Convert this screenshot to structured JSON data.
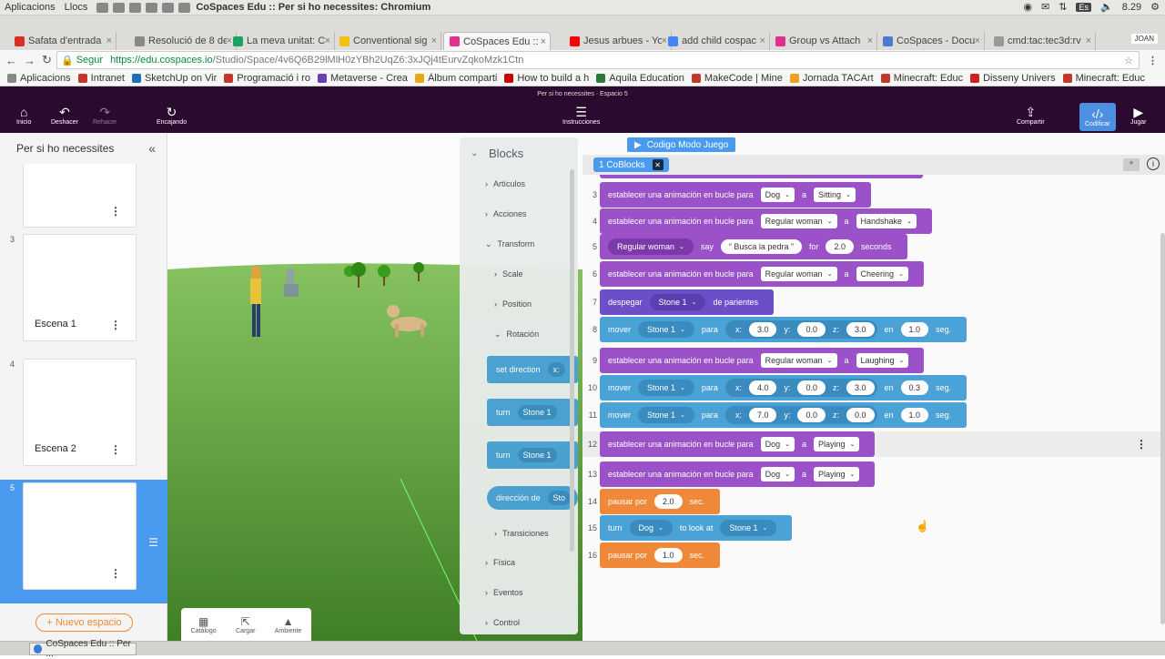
{
  "system": {
    "menus": [
      "Aplicacions",
      "Llocs"
    ],
    "window_title": "CoSpaces Edu :: Per si ho necessites: Chromium",
    "keyboard": "Es",
    "time": "8.29"
  },
  "browser": {
    "tabs": [
      {
        "label": "Safata d'entrada",
        "color": "#d93025"
      },
      {
        "label": "Resolució de 8 de",
        "color": "#888888"
      },
      {
        "label": "La meva unitat: C",
        "color": "#1aa260"
      },
      {
        "label": "Conventional sig",
        "color": "#f4c20d"
      },
      {
        "label": "CoSpaces Edu :: P",
        "color": "#e0318f",
        "active": true
      },
      {
        "label": "Jesus arbues - Yo",
        "color": "#ff0000"
      },
      {
        "label": "add child cospac",
        "color": "#4285f4"
      },
      {
        "label": "Group vs Attach",
        "color": "#e0318f"
      },
      {
        "label": "CoSpaces - Docu",
        "color": "#4a7bd0"
      },
      {
        "label": "cmd:tac:tec3d:rv",
        "color": "#999999"
      }
    ],
    "user": "JOAN",
    "secure_label": "Segur",
    "url_host": "https://edu.cospaces.io",
    "url_path": "/Studio/Space/4v6Q6B29lMlH0zYBh2UqZ6:3xJQj4tEurvZqkoMzk1Ctn",
    "bookmarks": [
      {
        "label": "Aplicacions",
        "color": "#888888"
      },
      {
        "label": "Intranet",
        "color": "#c0392b"
      },
      {
        "label": "SketchUp on Vir",
        "color": "#1e6fb8"
      },
      {
        "label": "Programació i ro",
        "color": "#c0392b"
      },
      {
        "label": "Metaverse - Crea",
        "color": "#6a3fb8"
      },
      {
        "label": "Àlbum comparti",
        "color": "#e6a817"
      },
      {
        "label": "How to build a h",
        "color": "#cc0000"
      },
      {
        "label": "Aquila Education",
        "color": "#2c7a3a"
      },
      {
        "label": "MakeCode | Mine",
        "color": "#c0392b"
      },
      {
        "label": "Jornada TACArt",
        "color": "#f0a020"
      },
      {
        "label": "Minecraft: Educ",
        "color": "#c0392b"
      },
      {
        "label": "Disseny Univers",
        "color": "#cc2222"
      },
      {
        "label": "Minecraft: Educ",
        "color": "#c0392b"
      }
    ]
  },
  "app": {
    "subtitle": "Per si ho necessites · Espacio 5",
    "toolbar": {
      "home": "Inicio",
      "undo": "Deshacer",
      "redo": "Rehacer",
      "snap": "Encajando",
      "instructions": "Instrucciones",
      "share": "Compartir",
      "code": "Codificar",
      "play": "Jugar"
    }
  },
  "scenes": {
    "title": "Per si ho necessites",
    "items": [
      {
        "num": "",
        "name": ""
      },
      {
        "num": "3",
        "name": "Escena 1"
      },
      {
        "num": "4",
        "name": "Escena 2"
      },
      {
        "num": "5",
        "name": ""
      }
    ],
    "new_space": "+ Nuevo espacio"
  },
  "dock": [
    "Catálogo",
    "Cargar",
    "Ambiente"
  ],
  "palette": {
    "title": "Blocks",
    "categories": [
      "Artículos",
      "Acciones",
      "Transform",
      "Scale",
      "Position",
      "Rotación",
      "Transiciones",
      "Física",
      "Eventos",
      "Control"
    ],
    "blocks": [
      {
        "text": "set direction",
        "arg": "x:"
      },
      {
        "text": "turn",
        "arg": "Stone 1"
      },
      {
        "text": "turn",
        "arg": "Stone 1"
      },
      {
        "text": "dirección de",
        "arg": "Sto"
      }
    ]
  },
  "code": {
    "mode_label": "Codigo Modo Juego",
    "tab_label": "1   CoBlocks",
    "lines": [
      {
        "n": "3",
        "color": "purple",
        "parts": [
          [
            "t",
            "establecer una animación en bucle para"
          ],
          [
            "dd",
            "Dog"
          ],
          [
            "t",
            "a"
          ],
          [
            "dd",
            "Sitting"
          ]
        ]
      },
      {
        "n": "4",
        "color": "purple",
        "parts": [
          [
            "t",
            "establecer una animación en bucle para"
          ],
          [
            "dd",
            "Regular woman"
          ],
          [
            "t",
            "a"
          ],
          [
            "dd",
            "Handshake"
          ]
        ]
      },
      {
        "n": "5",
        "color": "purple",
        "parts": [
          [
            "pl",
            "Regular woman"
          ],
          [
            "t",
            "say"
          ],
          [
            "num",
            "“ Busca la pedra ”"
          ],
          [
            "t",
            "for"
          ],
          [
            "num",
            "2.0"
          ],
          [
            "t",
            "seconds"
          ]
        ]
      },
      {
        "n": "6",
        "color": "purple",
        "parts": [
          [
            "t",
            "establecer una animación en bucle para"
          ],
          [
            "dd",
            "Regular woman"
          ],
          [
            "t",
            "a"
          ],
          [
            "dd",
            "Cheering"
          ]
        ]
      },
      {
        "n": "7",
        "color": "indigo",
        "parts": [
          [
            "t",
            "despegar"
          ],
          [
            "pl",
            "Stone 1"
          ],
          [
            "t",
            "de parientes"
          ]
        ]
      },
      {
        "n": "8",
        "color": "blue",
        "parts": [
          [
            "t",
            "mover"
          ],
          [
            "pl",
            "Stone 1"
          ],
          [
            "t",
            "para"
          ],
          [
            "xyz",
            [
              "3.0",
              "0.0",
              "3.0"
            ]
          ],
          [
            "t",
            "en"
          ],
          [
            "num",
            "1.0"
          ],
          [
            "t",
            "seg."
          ]
        ]
      },
      {
        "n": "9",
        "color": "purple",
        "parts": [
          [
            "t",
            "establecer una animación en bucle para"
          ],
          [
            "dd",
            "Regular woman"
          ],
          [
            "t",
            "a"
          ],
          [
            "dd",
            "Laughing"
          ]
        ]
      },
      {
        "n": "10",
        "color": "blue",
        "parts": [
          [
            "t",
            "mover"
          ],
          [
            "pl",
            "Stone 1"
          ],
          [
            "t",
            "para"
          ],
          [
            "xyz",
            [
              "4.0",
              "0.0",
              "3.0"
            ]
          ],
          [
            "t",
            "en"
          ],
          [
            "num",
            "0.3"
          ],
          [
            "t",
            "seg."
          ]
        ]
      },
      {
        "n": "11",
        "color": "blue",
        "parts": [
          [
            "t",
            "mover"
          ],
          [
            "pl",
            "Stone 1"
          ],
          [
            "t",
            "para"
          ],
          [
            "xyz",
            [
              "7.0",
              "0.0",
              "0.0"
            ]
          ],
          [
            "t",
            "en"
          ],
          [
            "num",
            "1.0"
          ],
          [
            "t",
            "seg."
          ]
        ]
      },
      {
        "n": "12",
        "color": "purple",
        "highlight": true,
        "parts": [
          [
            "t",
            "establecer una animación en bucle para"
          ],
          [
            "dd",
            "Dog"
          ],
          [
            "t",
            "a"
          ],
          [
            "dd",
            "Playing"
          ]
        ]
      },
      {
        "n": "13",
        "color": "purple",
        "parts": [
          [
            "t",
            "establecer una animación en bucle para"
          ],
          [
            "dd",
            "Dog"
          ],
          [
            "t",
            "a"
          ],
          [
            "dd",
            "Playing"
          ]
        ]
      },
      {
        "n": "14",
        "color": "orange",
        "parts": [
          [
            "t",
            "pausar por"
          ],
          [
            "num",
            "2.0"
          ],
          [
            "t",
            "sec."
          ]
        ]
      },
      {
        "n": "15",
        "color": "blue",
        "parts": [
          [
            "t",
            "turn"
          ],
          [
            "pl",
            "Dog"
          ],
          [
            "t",
            "to look at"
          ],
          [
            "pl",
            "Stone 1"
          ]
        ]
      },
      {
        "n": "16",
        "color": "orange",
        "parts": [
          [
            "t",
            "pausar por"
          ],
          [
            "num",
            "1.0"
          ],
          [
            "t",
            "sec."
          ]
        ]
      }
    ]
  },
  "taskbar": {
    "item": "CoSpaces Edu :: Per ..."
  }
}
